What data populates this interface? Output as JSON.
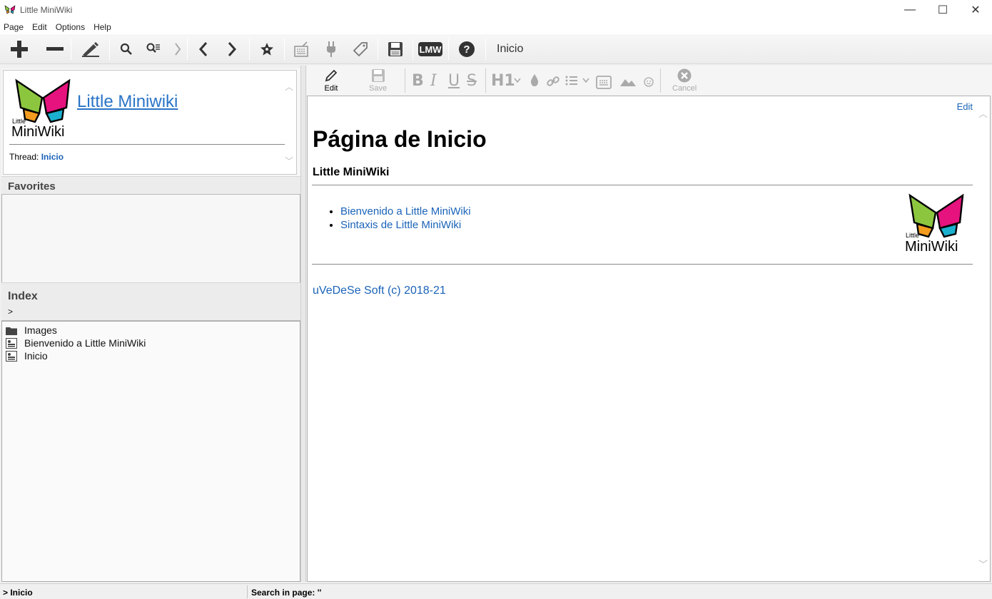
{
  "window": {
    "title": "Little MiniWiki",
    "controls": {
      "minimize": "—",
      "maximize": "☐",
      "close": "✕"
    }
  },
  "menu": [
    "Page",
    "Edit",
    "Options",
    "Help"
  ],
  "toolbar": {
    "buttons": [
      "add-icon",
      "remove-icon",
      "edit-pen-icon",
      "search-icon",
      "search-list-icon",
      "chevron-right-icon",
      "back-icon",
      "forward-icon",
      "favorite-star-icon",
      "keyboard-icon",
      "plug-icon",
      "tag-icon",
      "save-disk-icon",
      "lmw-icon",
      "help-icon"
    ],
    "lmw_label": "LMW",
    "current_page": "Inicio"
  },
  "left_panel": {
    "wiki_title": "Little Miniwiki",
    "logo_small_text": "Little",
    "logo_text": "MiniWiki",
    "thread_label": "Thread:",
    "thread_value": "Inicio",
    "favorites": {
      "title": "Favorites",
      "items": []
    },
    "index": {
      "title": "Index",
      "path": ">",
      "items": [
        {
          "label": "Images",
          "icon": "folder-icon"
        },
        {
          "label": "Bienvenido a Little MiniWiki",
          "icon": "page-icon"
        },
        {
          "label": "Inicio",
          "icon": "page-icon"
        }
      ]
    }
  },
  "edit_toolbar": {
    "edit_label": "Edit",
    "save_label": "Save",
    "cancel_label": "Cancel",
    "format_icons": [
      "bold-icon",
      "italic-icon",
      "underline-icon",
      "strikethrough-icon",
      "heading-icon",
      "color-drop-icon",
      "link-icon",
      "list-icon",
      "template-icon",
      "image-icon",
      "emoji-icon"
    ],
    "bold_glyph": "B",
    "italic_glyph": "I",
    "underline_glyph": "U",
    "strike_glyph": "S",
    "heading_glyph": "H1"
  },
  "content": {
    "edit_link": "Edit",
    "heading": "Página de Inicio",
    "subheading": "Little MiniWiki",
    "links": [
      "Bienvenido a Little MiniWiki",
      "Sintaxis de Little MiniWiki"
    ],
    "logo_small_text": "Little",
    "logo_text": "MiniWiki",
    "footer": "uVeDeSe Soft (c) 2018-21"
  },
  "status_bar": {
    "left": "> Inicio",
    "right": "Search in page: ''"
  },
  "colors": {
    "link": "#1a63b8",
    "logo_green": "#8cc63f",
    "logo_pink": "#e6127e",
    "logo_orange": "#f39c1f",
    "logo_cyan": "#1bb0ce"
  }
}
